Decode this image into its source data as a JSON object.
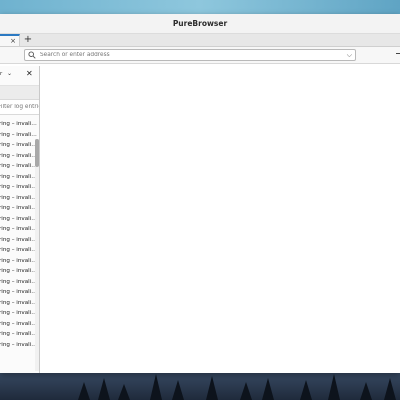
{
  "window": {
    "title": "PureBrowser"
  },
  "tabs": {
    "close_glyph": "×",
    "new_tab_glyph": "+"
  },
  "navbar": {
    "url_placeholder": "Search or enter address",
    "dropdown_glyph": "⌵"
  },
  "sidebar": {
    "header_fragment": "r",
    "chevron_glyph": "⌄",
    "close_glyph": "✕",
    "filter_placeholder": "Filter log entries",
    "log_entries": [
      "ring – invali…",
      "ring – invali…",
      "ring – invali…",
      "ring – invali…",
      "ring – invali…",
      "ring – invali…",
      "ring – invali…",
      "ring – invali…",
      "ring – invali…",
      "ring – invali…",
      "ring – invali…",
      "ring – invali…",
      "ring – invali…",
      "ring – invali…",
      "ring – invali…",
      "ring – invali…",
      "ring – invali…",
      "ring – invali…",
      "ring – invali…",
      "ring – invali…",
      "ring – invali…",
      "ring – invali…"
    ],
    "scroll_position": 0.0
  },
  "colors": {
    "tab_accent": "#2b79c2",
    "window_bg": "#ffffff",
    "chrome_bg": "#f3f3f3"
  }
}
